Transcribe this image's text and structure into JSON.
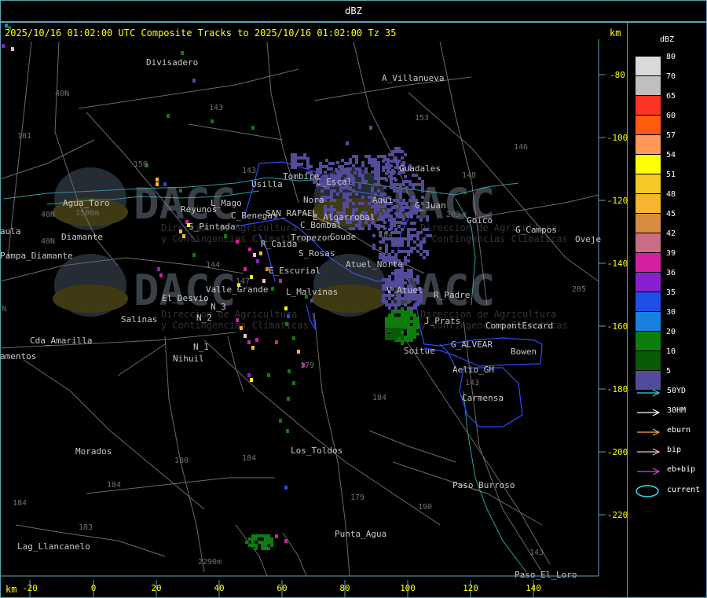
{
  "window": {
    "title": "dBZ"
  },
  "header": {
    "text": "2025/10/16 01:02:00 UTC Composite Tracks to 2025/10/16 01:02:00 Tz 35",
    "km_right": "km",
    "km_bottom": "km"
  },
  "axes": {
    "x_ticks": [
      "-20",
      "0",
      "20",
      "40",
      "60",
      "80",
      "100",
      "120",
      "140"
    ],
    "y_ticks": [
      "-80",
      "-100",
      "-120",
      "-140",
      "-160",
      "-180",
      "-200",
      "-220"
    ]
  },
  "places": [
    {
      "name": "Divisadero"
    },
    {
      "name": "A_Villanueva"
    },
    {
      "name": "Guadales"
    },
    {
      "name": "Tombire"
    },
    {
      "name": "Usilla"
    },
    {
      "name": "C_Escal"
    },
    {
      "name": "Aqui"
    },
    {
      "name": "Nora"
    },
    {
      "name": "G_Juan"
    },
    {
      "name": "Goico"
    },
    {
      "name": "G_Campos"
    },
    {
      "name": "Oveje"
    },
    {
      "name": "Agua_Toro"
    },
    {
      "name": "Reyunos"
    },
    {
      "name": "L_Mago"
    },
    {
      "name": "C_Benegas"
    },
    {
      "name": "SAN_RAFAEL"
    },
    {
      "name": "E_Algarrobal"
    },
    {
      "name": "C_Bombal"
    },
    {
      "name": "Diamante"
    },
    {
      "name": "S_Pintada"
    },
    {
      "name": "Tropezon"
    },
    {
      "name": "Goude"
    },
    {
      "name": "R_Caida"
    },
    {
      "name": "S_Rosas"
    },
    {
      "name": "Atuel_Norte"
    },
    {
      "name": "E_Escurial"
    },
    {
      "name": "Pampa_Diamante"
    },
    {
      "name": "aula"
    },
    {
      "name": "Valle_Grande"
    },
    {
      "name": "L_Malvinas"
    },
    {
      "name": "V_Atuel"
    },
    {
      "name": "R_Padre"
    },
    {
      "name": "El_Desvio"
    },
    {
      "name": "N_3"
    },
    {
      "name": "N_2"
    },
    {
      "name": "Salinas"
    },
    {
      "name": "J_Prats"
    },
    {
      "name": "CompantEscard"
    },
    {
      "name": "Cda_Amarilla"
    },
    {
      "name": "N_1"
    },
    {
      "name": "G_ALVEAR"
    },
    {
      "name": "Bowen"
    },
    {
      "name": "Nihuil"
    },
    {
      "name": "Soitue"
    },
    {
      "name": "amentos"
    },
    {
      "name": "Aelio_GH"
    },
    {
      "name": "Carmensa"
    },
    {
      "name": "Morados"
    },
    {
      "name": "Los_Toldos"
    },
    {
      "name": "Paso_Burroso"
    },
    {
      "name": "Punta_Agua"
    },
    {
      "name": "Lag_Llancanelo"
    },
    {
      "name": "Paso_El_Loro"
    }
  ],
  "route_labels": [
    "40N",
    "40N",
    "40N",
    "143",
    "143",
    "153",
    "146",
    "101",
    "150",
    "203",
    "148",
    "144",
    "147",
    "205",
    "179",
    "184",
    "180",
    "184",
    "184",
    "184",
    "183",
    "179",
    "190",
    "143",
    "143",
    "184",
    "2290m",
    "1500m",
    "N"
  ],
  "watermark": {
    "text": "DACC",
    "line1": "Direccion de Agricultura",
    "line2": "y Contingencias Climaticas"
  },
  "legend": {
    "title": "dBZ",
    "items": [
      {
        "label": "80",
        "color": "#d9d9d9"
      },
      {
        "label": "70",
        "color": "#bfbfbf"
      },
      {
        "label": "65",
        "color": "#ff3322"
      },
      {
        "label": "60",
        "color": "#ff5a10"
      },
      {
        "label": "57",
        "color": "#ff9955"
      },
      {
        "label": "54",
        "color": "#ffff00"
      },
      {
        "label": "51",
        "color": "#f7c825"
      },
      {
        "label": "48",
        "color": "#f5b530"
      },
      {
        "label": "45",
        "color": "#d88c3f"
      },
      {
        "label": "42",
        "color": "#c86d86"
      },
      {
        "label": "39",
        "color": "#d41fa0"
      },
      {
        "label": "36",
        "color": "#8a1fcf"
      },
      {
        "label": "35",
        "color": "#1f4fe6"
      },
      {
        "label": "30",
        "color": "#1a80e0"
      },
      {
        "label": "20",
        "color": "#0d7d0d"
      },
      {
        "label": "10",
        "color": "#0a5a0a"
      },
      {
        "label": "5",
        "color": "#534b9a"
      }
    ],
    "tracks": [
      {
        "label": "50YD",
        "color": "#33ddee"
      },
      {
        "label": "30HM",
        "color": "#ffffff"
      },
      {
        "label": "eburn",
        "color": "#ffb030"
      },
      {
        "label": "bip",
        "color": "#ffb8d0"
      },
      {
        "label": "eb+bip",
        "color": "#e040e0"
      }
    ],
    "current": {
      "label": "current",
      "color": "#33ddee"
    }
  }
}
